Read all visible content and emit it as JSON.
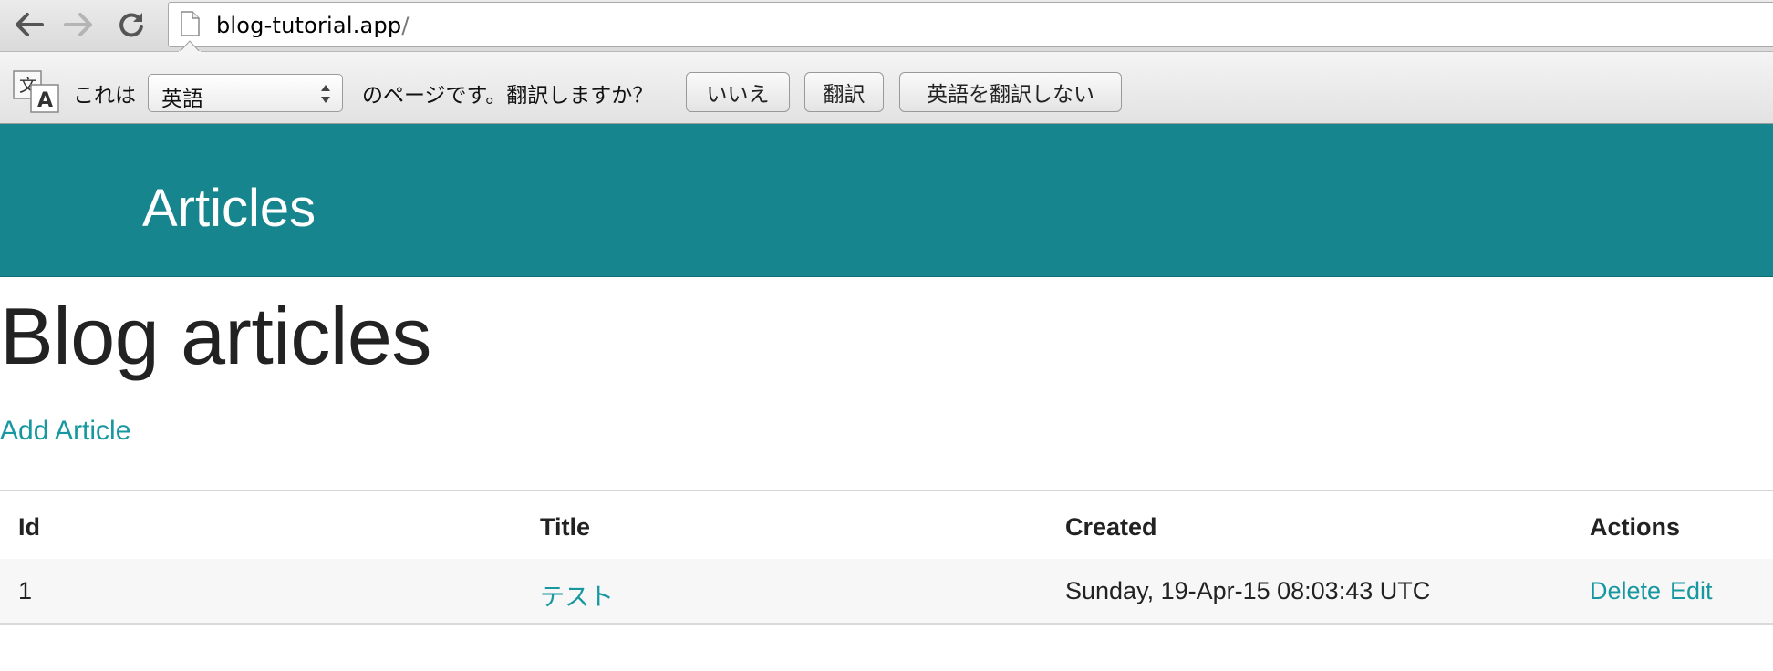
{
  "browser": {
    "url_host": "blog-tutorial.app",
    "url_path": "/"
  },
  "translate_bar": {
    "prefix": "これは",
    "language": "英語",
    "suffix": "のページです。翻訳しますか？",
    "no_button": "いいえ",
    "translate_button": "翻訳",
    "never_button": "英語を翻訳しない"
  },
  "header": {
    "title": "Articles"
  },
  "main": {
    "heading": "Blog articles",
    "add_link": "Add Article"
  },
  "table": {
    "columns": [
      "Id",
      "Title",
      "Created",
      "Actions"
    ],
    "rows": [
      {
        "id": "1",
        "title": "テスト",
        "created": "Sunday, 19-Apr-15 08:03:43 UTC",
        "actions": [
          "Delete",
          "Edit"
        ]
      }
    ]
  },
  "colors": {
    "header_bg": "#17858e",
    "link": "#1798a0"
  },
  "icons": [
    "back-arrow-icon",
    "forward-arrow-icon",
    "reload-icon",
    "page-icon",
    "translate-icon"
  ]
}
